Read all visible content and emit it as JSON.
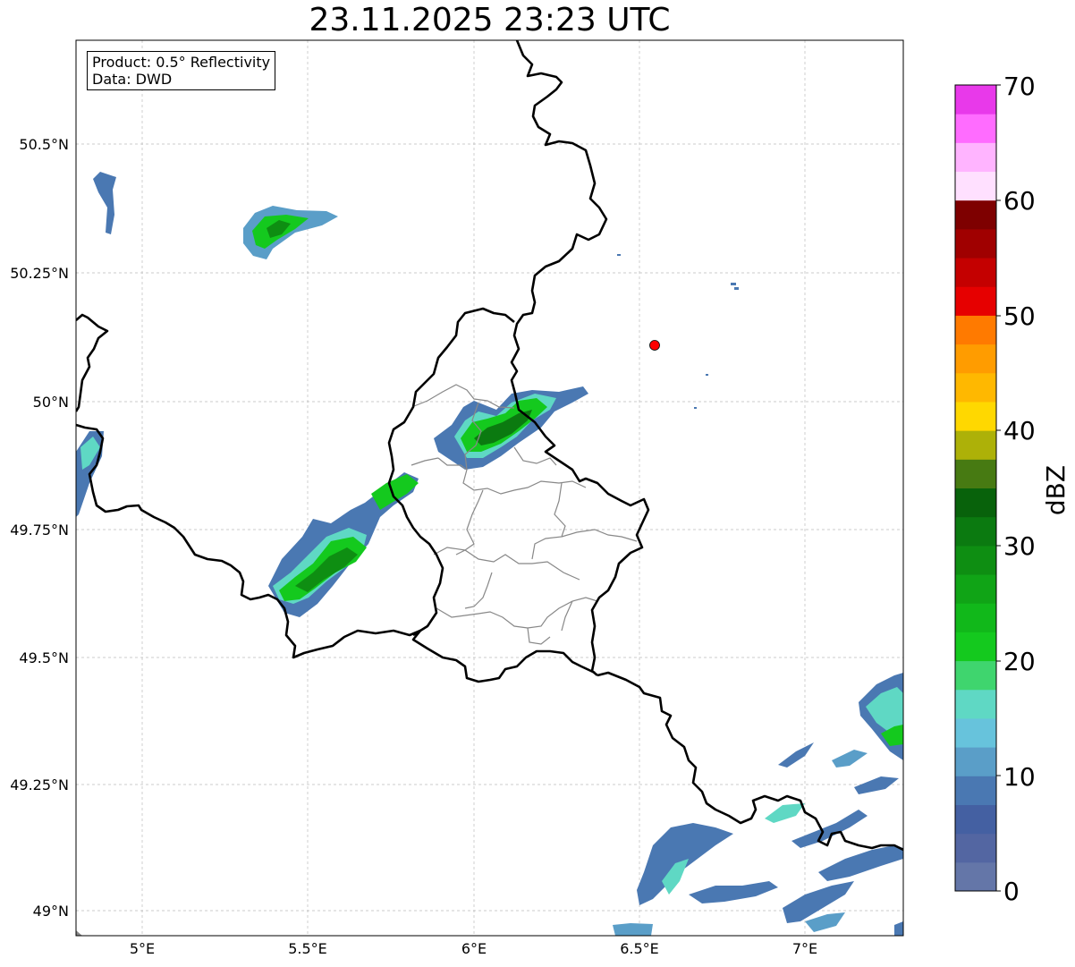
{
  "title": "23.11.2025 23:23 UTC",
  "info": {
    "product": "Product: 0.5° Reflectivity",
    "source": "Data: DWD"
  },
  "axes": {
    "x_ticks": [
      "5°E",
      "5.5°E",
      "6°E",
      "6.5°E",
      "7°E"
    ],
    "y_ticks": [
      "49°N",
      "49.25°N",
      "49.5°N",
      "49.75°N",
      "50°N",
      "50.25°N",
      "50.5°N"
    ],
    "lon_range": [
      4.8,
      7.3
    ],
    "lat_range": [
      48.95,
      50.7
    ]
  },
  "colorbar": {
    "label": "dBZ",
    "ticks": [
      "0",
      "10",
      "20",
      "30",
      "40",
      "50",
      "60",
      "70"
    ],
    "colors": [
      "#6476a8",
      "#5366a2",
      "#4460a2",
      "#4a78b2",
      "#5a9ec8",
      "#67c3dc",
      "#5fd8c4",
      "#3fd56e",
      "#14c91e",
      "#11b81a",
      "#10a416",
      "#0e8e12",
      "#0b7a10",
      "#08620b",
      "#477a12",
      "#adb108",
      "#ffd800",
      "#ffb800",
      "#ff9c00",
      "#ff7a00",
      "#e60000",
      "#c40000",
      "#a00000",
      "#7e0000",
      "#ffe0ff",
      "#ffb4ff",
      "#ff6cff",
      "#e839ea"
    ]
  },
  "colors": {
    "border_country": "#000000",
    "border_region": "#888888",
    "grid": "#bbbbbb",
    "radar_site": "#ff0000"
  },
  "radar_site": {
    "lon": 6.55,
    "lat": 50.11
  }
}
